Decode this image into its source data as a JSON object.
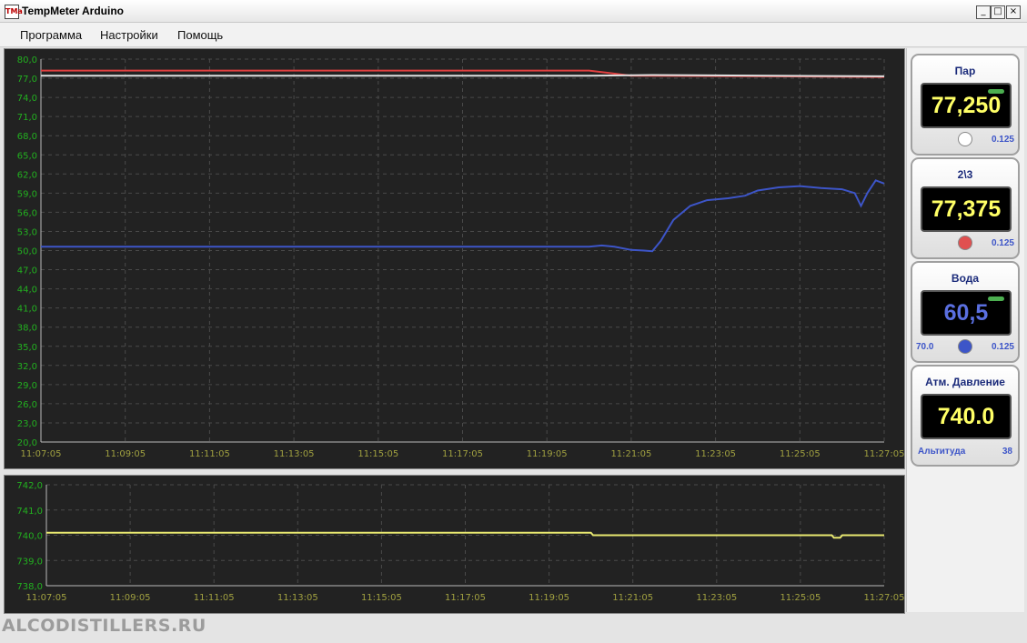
{
  "window": {
    "title": "TempMeter Arduino",
    "icon_name": "tempmeter-app-icon",
    "icon_text": "TMa",
    "controls": {
      "minimize": "_",
      "maximize": "□",
      "close": "×"
    }
  },
  "menu": {
    "items": [
      "Программа",
      "Настройки",
      "Помощь"
    ]
  },
  "sensors": [
    {
      "title": "Пар",
      "value": "77,250",
      "value_color": "#ffff66",
      "indicator_color": "#ffffff",
      "step": "0.125",
      "left_note": "",
      "has_bar": true
    },
    {
      "title": "2\\3",
      "value": "77,375",
      "value_color": "#ffff66",
      "indicator_color": "#e05050",
      "step": "0.125",
      "left_note": "",
      "has_bar": false
    },
    {
      "title": "Вода",
      "value": "60,5",
      "value_color": "#5a6fe0",
      "indicator_color": "#3d55c8",
      "step": "0.125",
      "left_note": "70.0",
      "has_bar": true
    },
    {
      "title": "Атм. Давление",
      "value": "740.0",
      "value_color": "#ffff66",
      "indicator_color": "",
      "step": "38",
      "left_note": "Альтитуда",
      "has_bar": false
    }
  ],
  "watermark": "ALCODISTILLERS.RU",
  "colors": {
    "plot_bg": "#222222",
    "grid": "#4a4a4a",
    "y_tick": "#22b020",
    "x_tick": "#a0a040"
  },
  "chart_data": [
    {
      "type": "line",
      "title": "",
      "ylim": [
        20,
        80
      ],
      "y_ticks": [
        "20,0",
        "23,0",
        "26,0",
        "29,0",
        "32,0",
        "35,0",
        "38,0",
        "41,0",
        "44,0",
        "47,0",
        "50,0",
        "53,0",
        "56,0",
        "59,0",
        "62,0",
        "65,0",
        "68,0",
        "71,0",
        "74,0",
        "77,0",
        "80,0"
      ],
      "x_ticks": [
        "11:07:05",
        "11:09:05",
        "11:11:05",
        "11:13:05",
        "11:15:05",
        "11:17:05",
        "11:19:05",
        "11:21:05",
        "11:23:05",
        "11:25:05",
        "11:27:05"
      ],
      "x_range_min": [
        0,
        20
      ],
      "series": [
        {
          "color": "#e04040",
          "x": [
            0,
            13,
            13.5,
            14,
            20
          ],
          "y": [
            78.2,
            78.2,
            77.8,
            77.4,
            77.2
          ]
        },
        {
          "color": "#e0e0e0",
          "x": [
            0,
            13,
            14.5,
            20
          ],
          "y": [
            77.4,
            77.4,
            77.5,
            77.3
          ]
        },
        {
          "color": "#3d55c8",
          "x": [
            0,
            13,
            13.3,
            13.6,
            14,
            14.3,
            14.5,
            14.7,
            15,
            15.4,
            15.8,
            16.3,
            16.7,
            17,
            17.5,
            18,
            18.5,
            19,
            19.3,
            19.45,
            19.6,
            19.8,
            20
          ],
          "y": [
            50.6,
            50.6,
            50.8,
            50.6,
            50.1,
            50.0,
            49.9,
            51.5,
            54.8,
            57.0,
            57.9,
            58.2,
            58.6,
            59.4,
            59.9,
            60.1,
            59.8,
            59.6,
            59.0,
            57.0,
            59.0,
            61.0,
            60.5
          ]
        }
      ]
    },
    {
      "type": "line",
      "title": "",
      "ylim": [
        738,
        742
      ],
      "y_ticks": [
        "738,0",
        "739,0",
        "740,0",
        "741,0",
        "742,0"
      ],
      "x_ticks": [
        "11:07:05",
        "11:09:05",
        "11:11:05",
        "11:13:05",
        "11:15:05",
        "11:17:05",
        "11:19:05",
        "11:21:05",
        "11:23:05",
        "11:25:05",
        "11:27:05"
      ],
      "x_range_min": [
        0,
        20
      ],
      "series": [
        {
          "color": "#e8e870",
          "x": [
            0,
            13,
            13.05,
            18.75,
            18.8,
            18.95,
            19.0,
            20
          ],
          "y": [
            740.1,
            740.1,
            740.0,
            740.0,
            739.9,
            739.9,
            740.0,
            740.0
          ]
        }
      ]
    }
  ]
}
